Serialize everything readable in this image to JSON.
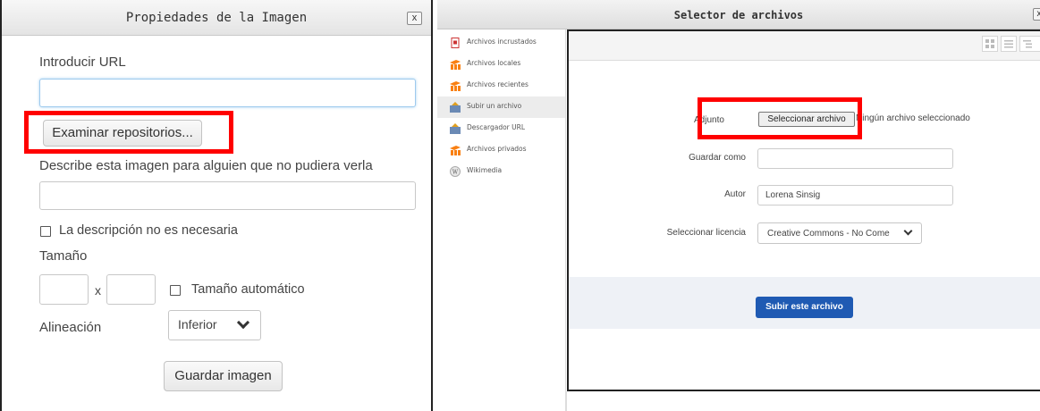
{
  "image_properties": {
    "title": "Propiedades de la Imagen",
    "close_label": "x",
    "url_label": "Introducir URL",
    "url_value": "",
    "browse_button": "Examinar repositorios...",
    "description_label": "Describe esta imagen para alguien que no pudiera verla",
    "description_value": "",
    "decorative_label": "La descripción no es necesaria",
    "size_label": "Tamaño",
    "width_value": "",
    "size_separator": "x",
    "height_value": "",
    "auto_size_label": "Tamaño automático",
    "alignment_label": "Alineación",
    "alignment_value": "Inferior",
    "save_button": "Guardar imagen"
  },
  "file_picker": {
    "title": "Selector de archivos",
    "close_label": "x",
    "repositories": [
      {
        "label": "Archivos incrustados",
        "icon": "embedded-files-icon",
        "active": false
      },
      {
        "label": "Archivos locales",
        "icon": "moodle-icon",
        "active": false
      },
      {
        "label": "Archivos recientes",
        "icon": "moodle-icon",
        "active": false
      },
      {
        "label": "Subir un archivo",
        "icon": "upload-icon",
        "active": true
      },
      {
        "label": "Descargador URL",
        "icon": "url-download-icon",
        "active": false
      },
      {
        "label": "Archivos privados",
        "icon": "moodle-icon",
        "active": false
      },
      {
        "label": "Wikimedia",
        "icon": "wikimedia-icon",
        "active": false
      }
    ],
    "attachment_label": "Adjunto",
    "choose_file_button": "Seleccionar archivo",
    "no_file_text": "Ningún archivo seleccionado",
    "save_as_label": "Guardar como",
    "save_as_value": "",
    "author_label": "Autor",
    "author_value": "Lorena Sinsig",
    "license_label": "Seleccionar licencia",
    "license_value": "Creative Commons - No Come",
    "upload_button": "Subir este archivo"
  },
  "colors": {
    "highlight": "#ff0000",
    "primary_button": "#1f5ab3",
    "footer_bg": "#eef1f6"
  }
}
